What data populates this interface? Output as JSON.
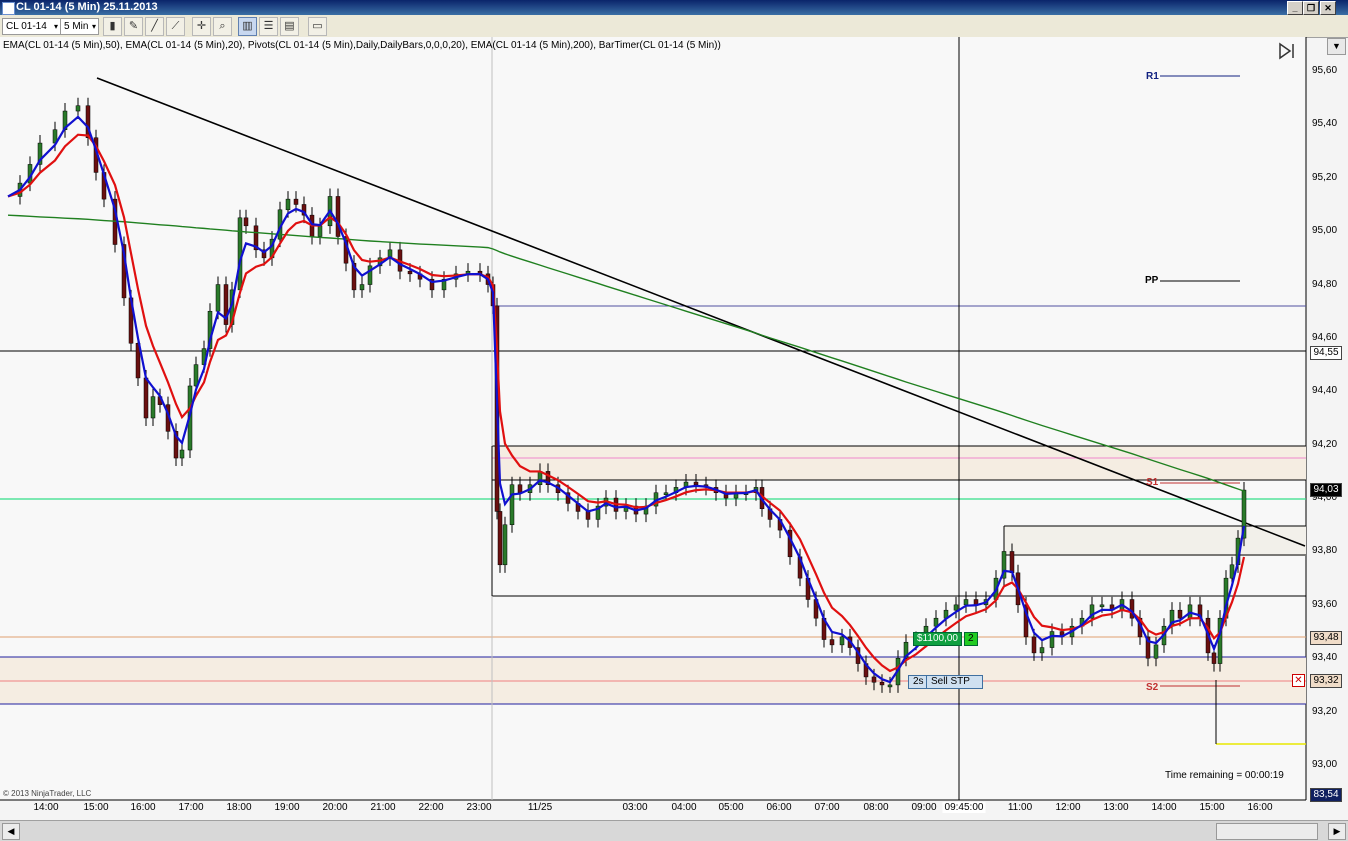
{
  "window": {
    "title": "CL 01-14 (5 Min)  25.11.2013",
    "buttons": {
      "minimize": "_",
      "restore": "❐",
      "close": "✕"
    }
  },
  "toolbar": {
    "instrument": "CL 01-14",
    "interval": "5 Min",
    "dropdown_arrow": "▾",
    "icons": [
      "bar-type-icon",
      "pencil-icon",
      "drawing-tool-icon",
      "crosshair-icon",
      "zoom-icon",
      "chart-style-icon",
      "properties-icon",
      "template-icon",
      "window-icon"
    ]
  },
  "indicators_text": "EMA(CL 01-14 (5 Min),50), EMA(CL 01-14 (5 Min),20), Pivots(CL 01-14 (5 Min),Daily,DailyBars,0,0,0,20), EMA(CL 01-14 (5 Min),200), BarTimer(CL 01-14 (5 Min))",
  "price_axis": {
    "labels": [
      "95,60",
      "95,40",
      "95,20",
      "95,00",
      "94,80",
      "94,60",
      "94,40",
      "94,20",
      "94,00",
      "93,80",
      "93,60",
      "93,40",
      "93,20",
      "93,00"
    ],
    "tags": {
      "horizontal_line": "94,55",
      "last_price": "94,03",
      "stop_level": "93,48",
      "order_level": "93,32",
      "bottom": "83,54"
    }
  },
  "time_axis": {
    "labels": [
      "14:00",
      "15:00",
      "16:00",
      "17:00",
      "18:00",
      "19:00",
      "20:00",
      "21:00",
      "22:00",
      "23:00",
      "11/25",
      "03:00",
      "04:00",
      "05:00",
      "06:00",
      "07:00",
      "08:00",
      "09:00",
      "09:45:00",
      "11:00",
      "12:00",
      "13:00",
      "14:00",
      "15:00",
      "16:00"
    ]
  },
  "pivots": {
    "r1": "R1",
    "pp": "PP",
    "s1": "S1",
    "s2": "S2"
  },
  "position": {
    "pnl": "$1100,00",
    "qty": "2"
  },
  "order": {
    "qty": "2s",
    "type": "Sell STP"
  },
  "bar_timer": "Time remaining = 00:00:19",
  "copyright": "© 2013 NinjaTrader, LLC",
  "colors": {
    "ema50": "#e01010",
    "ema20": "#1010d0",
    "ema200": "#208020",
    "green_line": "#33dd88",
    "pink_line": "#ee88cc",
    "zone_fill": "#f5ede2",
    "up_candle": "#2a7a2a",
    "down_candle": "#6a1010"
  },
  "chart_data": {
    "type": "candlestick",
    "price_range": [
      92.94,
      95.68
    ],
    "series_lines": [
      "EMA 20",
      "EMA 50",
      "EMA 200"
    ]
  }
}
